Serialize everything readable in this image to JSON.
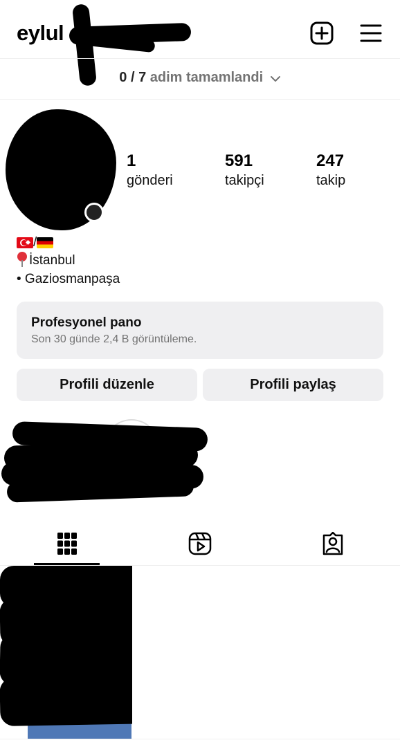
{
  "header": {
    "username": "eylul",
    "new_post_icon": "plus-square-icon",
    "menu_icon": "hamburger-menu-icon"
  },
  "steps": {
    "count": "0 / 7",
    "label": "adim tamamlandi",
    "chevron_icon": "chevron-down-icon"
  },
  "profile": {
    "stats": [
      {
        "number": "1",
        "label": "gönderi"
      },
      {
        "number": "591",
        "label": "takipçi"
      },
      {
        "number": "247",
        "label": "takip"
      }
    ],
    "bio": {
      "flags_separator": "/",
      "flags": [
        "turkey-flag",
        "germany-flag"
      ],
      "pin_icon": "round-pushpin-icon",
      "location": "İstanbul",
      "district": "• Gaziosmanpaşa"
    }
  },
  "dashboard": {
    "title": "Profesyonel pano",
    "subtitle": "Son 30 günde 2,4 B görüntüleme."
  },
  "actions": {
    "edit_profile": "Profili düzenle",
    "share_profile": "Profili paylaş"
  },
  "tabs": [
    {
      "icon": "grid-icon",
      "active": true
    },
    {
      "icon": "reels-icon",
      "active": false
    },
    {
      "icon": "tagged-icon",
      "active": false
    }
  ],
  "colors": {
    "card_bg": "#efeff1",
    "secondary_text": "#737373",
    "pin_red": "#e0303a"
  }
}
